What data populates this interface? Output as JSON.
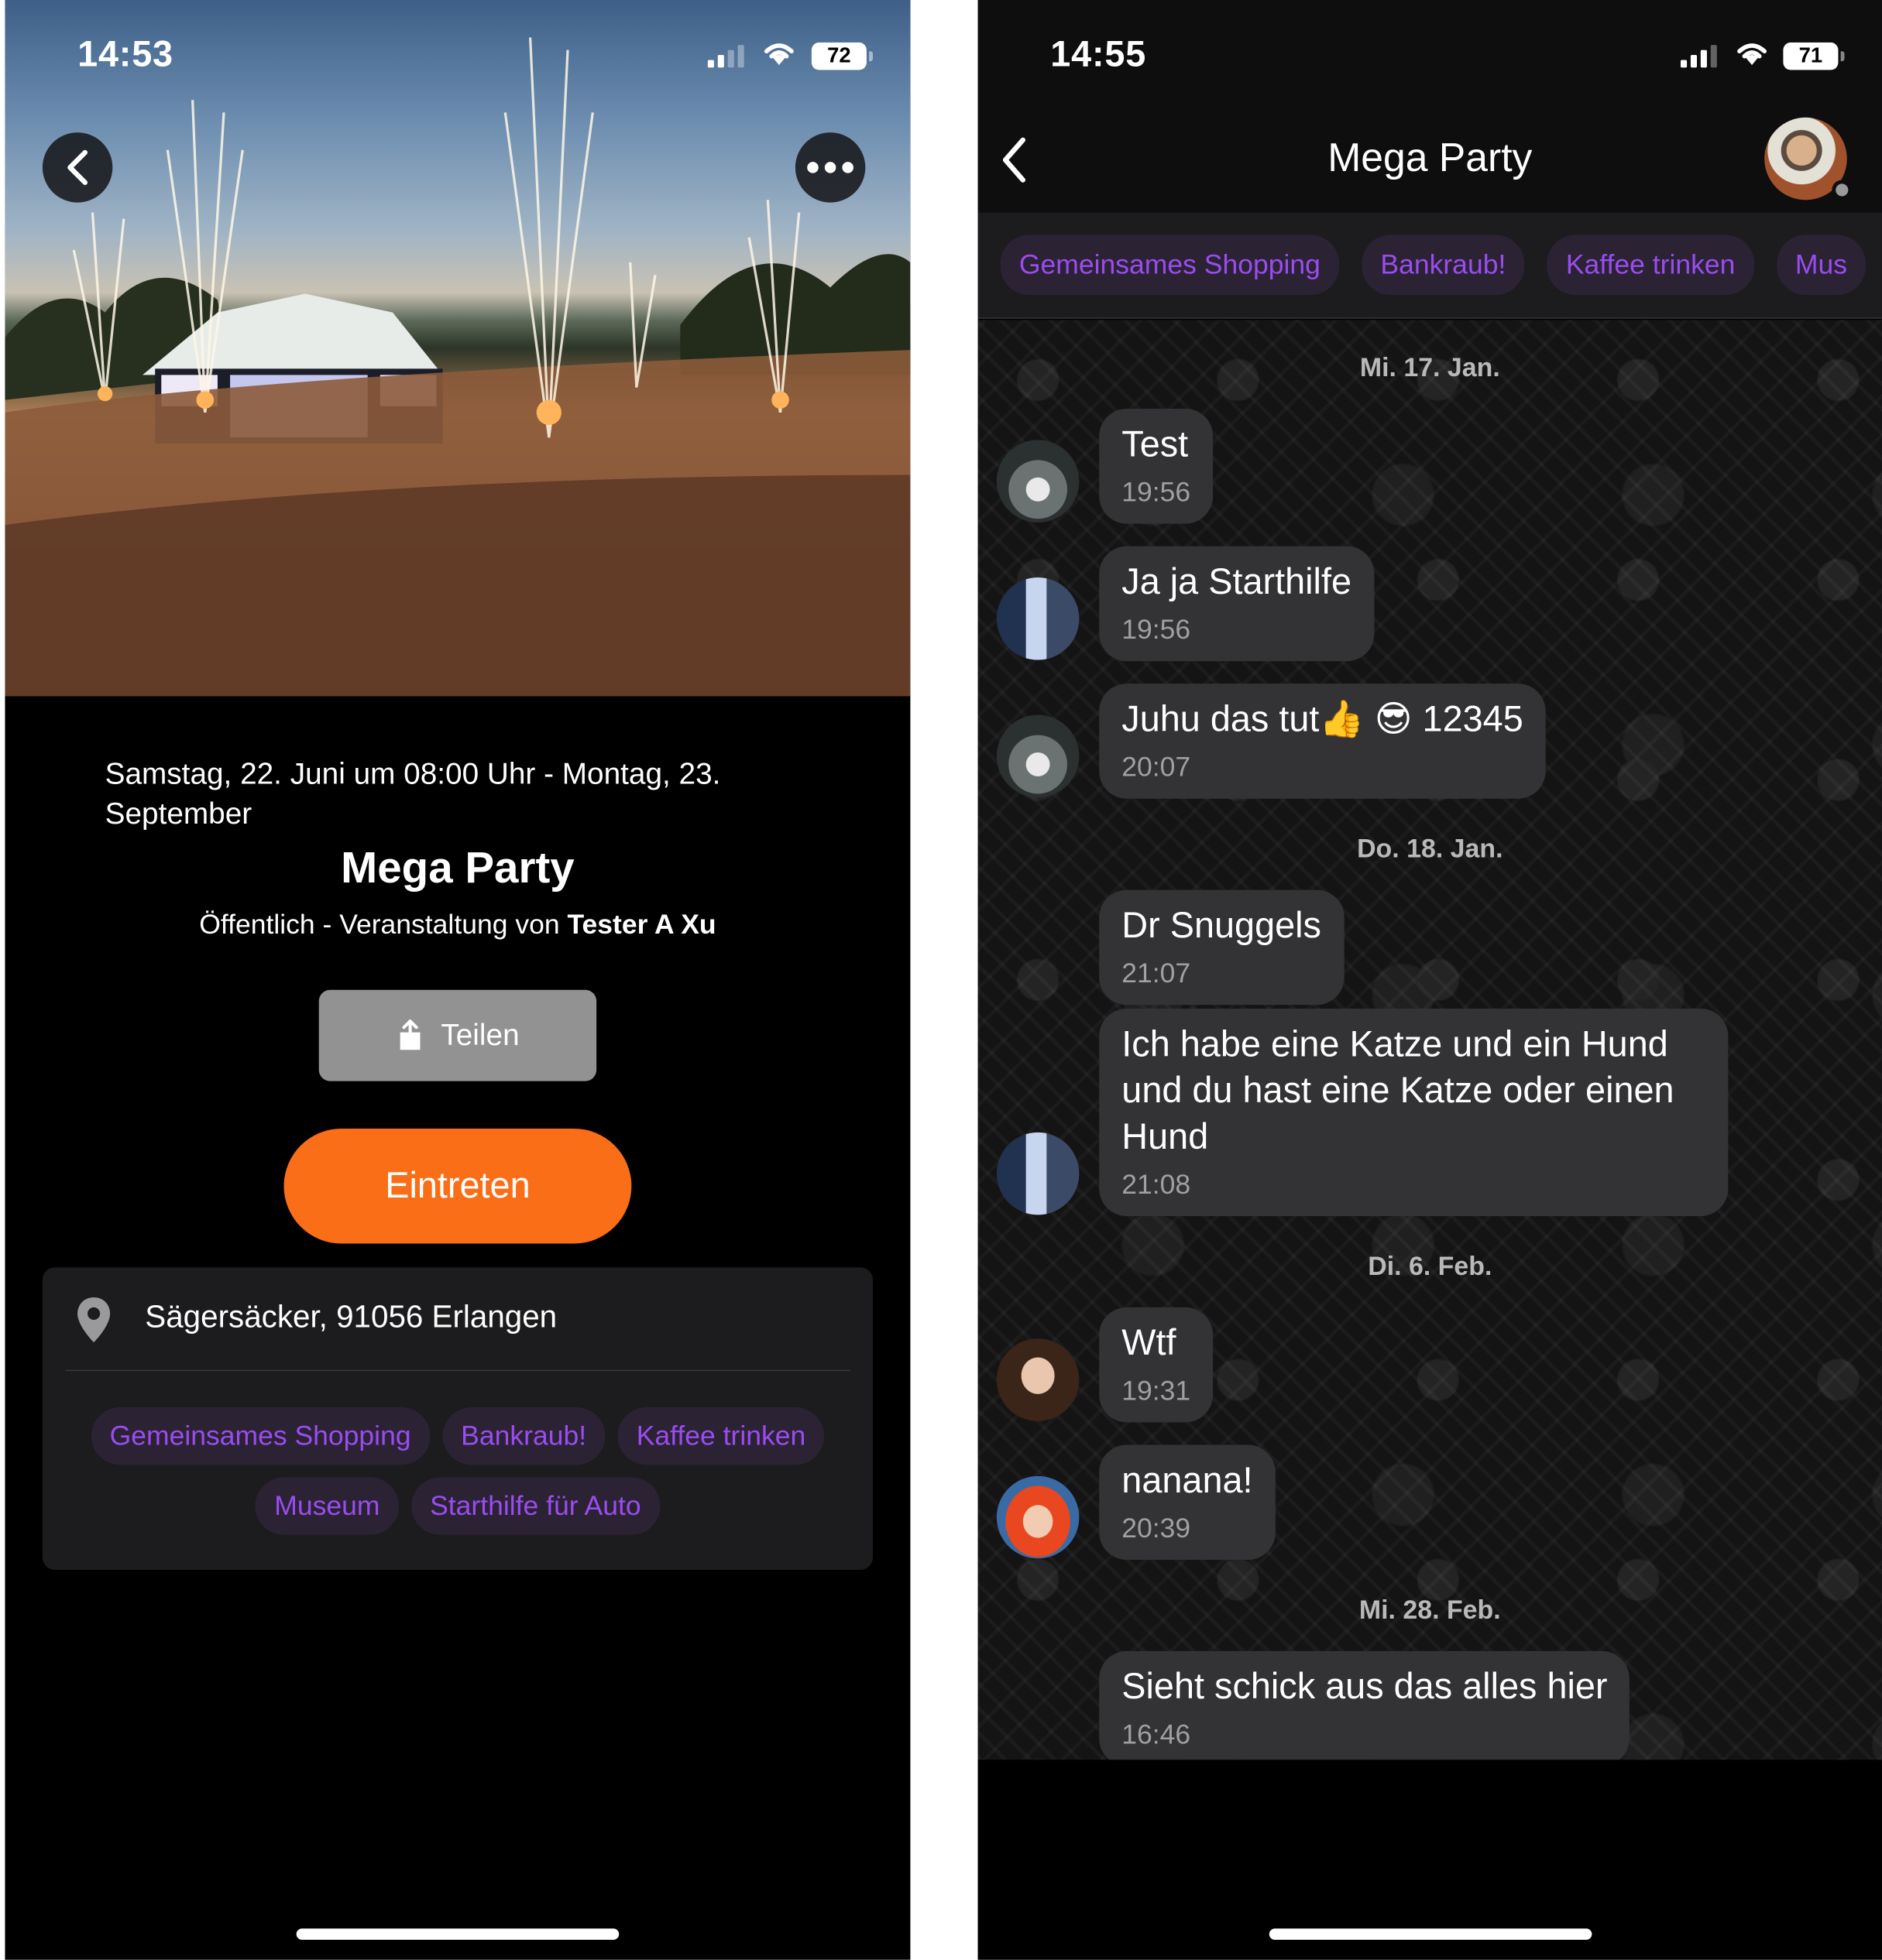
{
  "left_screen": {
    "status": {
      "time": "14:53",
      "battery": "72"
    },
    "event": {
      "date_range": "Samstag, 22. Juni um 08:00 Uhr - Montag, 23. September",
      "title": "Mega Party",
      "visibility_prefix": "Öffentlich - Veranstaltung von ",
      "organizer": "Tester A Xu"
    },
    "buttons": {
      "share": "Teilen",
      "enter": "Eintreten"
    },
    "location": "Sägersäcker, 91056 Erlangen",
    "tags": [
      "Gemeinsames Shopping",
      "Bankraub!",
      "Kaffee trinken",
      "Museum",
      "Starthilfe für Auto"
    ]
  },
  "right_screen": {
    "status": {
      "time": "14:55",
      "battery": "71"
    },
    "chat_title": "Mega Party",
    "tags": [
      "Gemeinsames Shopping",
      "Bankraub!",
      "Kaffee trinken",
      "Mus"
    ],
    "days": [
      {
        "label": "Mi. 17. Jan."
      },
      {
        "label": "Do. 18. Jan."
      },
      {
        "label": "Di. 6. Feb."
      },
      {
        "label": "Mi. 28. Feb."
      }
    ],
    "messages": [
      {
        "text": "Test",
        "time": "19:56",
        "avatar": "nike-avatar"
      },
      {
        "text": "Ja ja Starthilfe",
        "time": "19:56",
        "avatar": "couple-avatar"
      },
      {
        "text": "Juhu das tut👍 😎 12345",
        "time": "20:07",
        "avatar": "nike-avatar"
      },
      {
        "text": "Dr Snuggels",
        "time": "21:07",
        "avatar": ""
      },
      {
        "text": "Ich habe eine Katze und ein Hund und du hast eine Katze oder einen Hund",
        "time": "21:08",
        "avatar": "couple-avatar"
      },
      {
        "text": "Wtf",
        "time": "19:31",
        "avatar": "woman-avatar"
      },
      {
        "text": "nanana!",
        "time": "20:39",
        "avatar": "redhead-avatar"
      },
      {
        "text": "Sieht schick aus das alles hier",
        "time": "16:46",
        "avatar": ""
      }
    ]
  },
  "colors": {
    "accent_orange": "#fa6e17",
    "chip_text": "#9a4cf0",
    "chip_bg": "#2b2334",
    "bubble": "#333335"
  }
}
